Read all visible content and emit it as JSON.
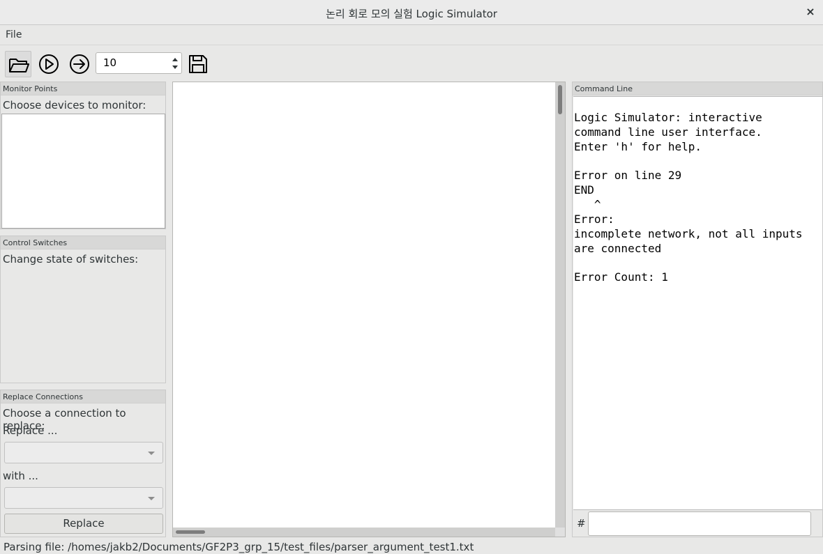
{
  "window": {
    "title": "논리 회로 모의 실험 Logic Simulator",
    "close_glyph": "×"
  },
  "menubar": {
    "items": [
      "File"
    ]
  },
  "toolbar": {
    "icons": [
      "open-folder-icon",
      "run-icon",
      "continue-icon",
      "save-icon"
    ],
    "cycles_value": "10"
  },
  "monitor_panel": {
    "title": "Monitor Points",
    "prompt": "Choose devices to monitor:"
  },
  "switch_panel": {
    "title": "Control Switches",
    "prompt": "Change state of switches:"
  },
  "replace_panel": {
    "title": "Replace Connections",
    "prompt": "Choose a connection to replace:",
    "replace_label": "Replace ...",
    "with_label": "with ...",
    "button_label": "Replace"
  },
  "command_panel": {
    "title": "Command Line",
    "lines": [
      "Logic Simulator: interactive",
      "command line user interface.",
      "Enter 'h' for help.",
      "",
      "Error on line 29",
      "END",
      "   ^",
      "Error:",
      "incomplete network, not all inputs",
      "are connected",
      "",
      "Error Count: 1"
    ],
    "prompt_symbol": "#",
    "input_value": ""
  },
  "statusbar": {
    "text": "Parsing file: /homes/jakb2/Documents/GF2P3_grp_15/test_files/parser_argument_test1.txt"
  }
}
